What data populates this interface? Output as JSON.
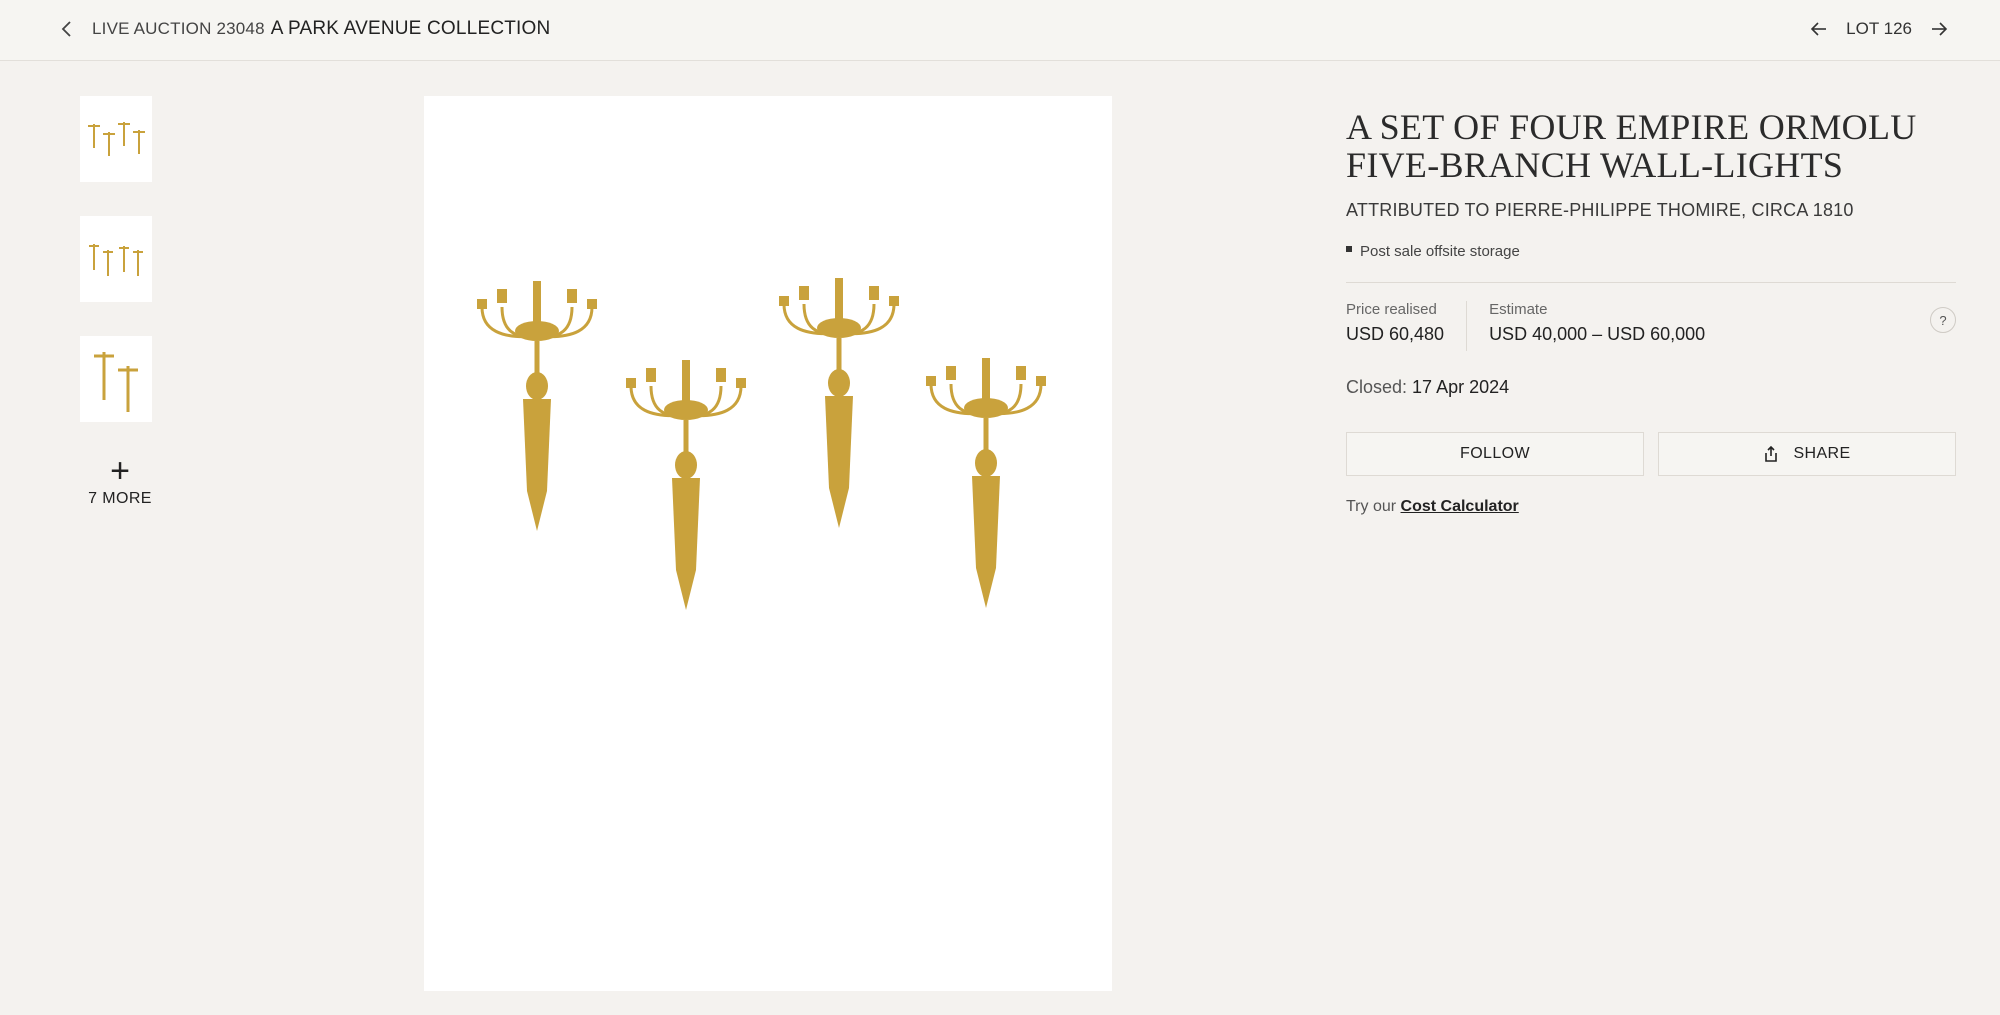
{
  "header": {
    "auction_label": "LIVE AUCTION 23048",
    "sale_title": "A PARK AVENUE COLLECTION",
    "lot_label": "LOT 126"
  },
  "gallery": {
    "more_label": "7 MORE",
    "thumbnails": [
      "thumbnail-1",
      "thumbnail-2",
      "thumbnail-3"
    ]
  },
  "lot": {
    "title": "A SET OF FOUR EMPIRE ORMOLU FIVE-BRANCH WALL-LIGHTS",
    "subtitle": "ATTRIBUTED TO PIERRE-PHILIPPE THOMIRE, CIRCA 1810",
    "storage_note": "Post sale offsite storage",
    "price_label": "Price realised",
    "price_value": "USD 60,480",
    "estimate_label": "Estimate",
    "estimate_value": "USD 40,000 – USD 60,000",
    "help_label": "?",
    "closed_label": "Closed:",
    "closed_date": "17 Apr 2024"
  },
  "actions": {
    "follow_label": "FOLLOW",
    "share_label": "SHARE",
    "cost_prefix": "Try our",
    "cost_link": "Cost Calculator"
  },
  "colors": {
    "page_bg": "#f4f2ef",
    "gold": "#c9a23c"
  },
  "icons": [
    "chevron-left-icon",
    "arrow-left-icon",
    "arrow-right-icon",
    "plus-icon",
    "share-icon",
    "help-icon"
  ]
}
